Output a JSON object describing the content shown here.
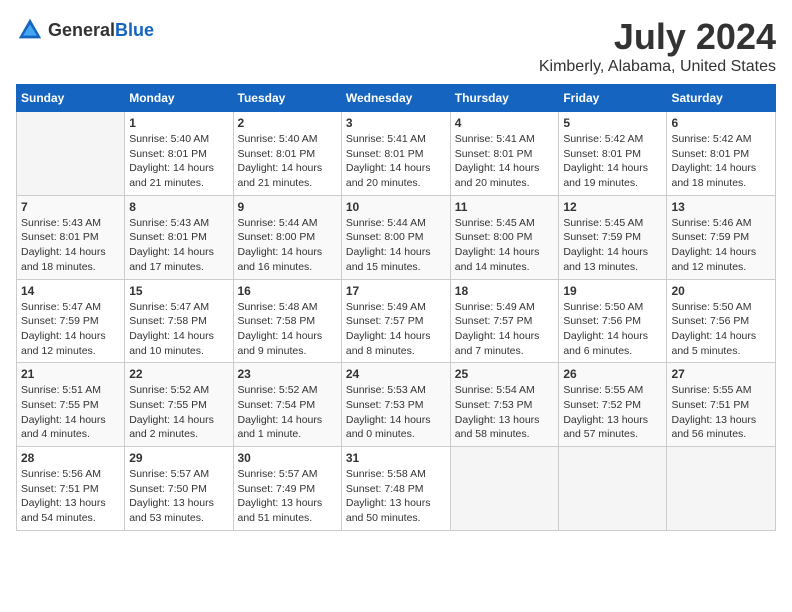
{
  "header": {
    "logo_general": "General",
    "logo_blue": "Blue",
    "title": "July 2024",
    "subtitle": "Kimberly, Alabama, United States"
  },
  "weekdays": [
    "Sunday",
    "Monday",
    "Tuesday",
    "Wednesday",
    "Thursday",
    "Friday",
    "Saturday"
  ],
  "weeks": [
    [
      {
        "day": "",
        "detail": ""
      },
      {
        "day": "1",
        "detail": "Sunrise: 5:40 AM\nSunset: 8:01 PM\nDaylight: 14 hours\nand 21 minutes."
      },
      {
        "day": "2",
        "detail": "Sunrise: 5:40 AM\nSunset: 8:01 PM\nDaylight: 14 hours\nand 21 minutes."
      },
      {
        "day": "3",
        "detail": "Sunrise: 5:41 AM\nSunset: 8:01 PM\nDaylight: 14 hours\nand 20 minutes."
      },
      {
        "day": "4",
        "detail": "Sunrise: 5:41 AM\nSunset: 8:01 PM\nDaylight: 14 hours\nand 20 minutes."
      },
      {
        "day": "5",
        "detail": "Sunrise: 5:42 AM\nSunset: 8:01 PM\nDaylight: 14 hours\nand 19 minutes."
      },
      {
        "day": "6",
        "detail": "Sunrise: 5:42 AM\nSunset: 8:01 PM\nDaylight: 14 hours\nand 18 minutes."
      }
    ],
    [
      {
        "day": "7",
        "detail": "Sunrise: 5:43 AM\nSunset: 8:01 PM\nDaylight: 14 hours\nand 18 minutes."
      },
      {
        "day": "8",
        "detail": "Sunrise: 5:43 AM\nSunset: 8:01 PM\nDaylight: 14 hours\nand 17 minutes."
      },
      {
        "day": "9",
        "detail": "Sunrise: 5:44 AM\nSunset: 8:00 PM\nDaylight: 14 hours\nand 16 minutes."
      },
      {
        "day": "10",
        "detail": "Sunrise: 5:44 AM\nSunset: 8:00 PM\nDaylight: 14 hours\nand 15 minutes."
      },
      {
        "day": "11",
        "detail": "Sunrise: 5:45 AM\nSunset: 8:00 PM\nDaylight: 14 hours\nand 14 minutes."
      },
      {
        "day": "12",
        "detail": "Sunrise: 5:45 AM\nSunset: 7:59 PM\nDaylight: 14 hours\nand 13 minutes."
      },
      {
        "day": "13",
        "detail": "Sunrise: 5:46 AM\nSunset: 7:59 PM\nDaylight: 14 hours\nand 12 minutes."
      }
    ],
    [
      {
        "day": "14",
        "detail": "Sunrise: 5:47 AM\nSunset: 7:59 PM\nDaylight: 14 hours\nand 12 minutes."
      },
      {
        "day": "15",
        "detail": "Sunrise: 5:47 AM\nSunset: 7:58 PM\nDaylight: 14 hours\nand 10 minutes."
      },
      {
        "day": "16",
        "detail": "Sunrise: 5:48 AM\nSunset: 7:58 PM\nDaylight: 14 hours\nand 9 minutes."
      },
      {
        "day": "17",
        "detail": "Sunrise: 5:49 AM\nSunset: 7:57 PM\nDaylight: 14 hours\nand 8 minutes."
      },
      {
        "day": "18",
        "detail": "Sunrise: 5:49 AM\nSunset: 7:57 PM\nDaylight: 14 hours\nand 7 minutes."
      },
      {
        "day": "19",
        "detail": "Sunrise: 5:50 AM\nSunset: 7:56 PM\nDaylight: 14 hours\nand 6 minutes."
      },
      {
        "day": "20",
        "detail": "Sunrise: 5:50 AM\nSunset: 7:56 PM\nDaylight: 14 hours\nand 5 minutes."
      }
    ],
    [
      {
        "day": "21",
        "detail": "Sunrise: 5:51 AM\nSunset: 7:55 PM\nDaylight: 14 hours\nand 4 minutes."
      },
      {
        "day": "22",
        "detail": "Sunrise: 5:52 AM\nSunset: 7:55 PM\nDaylight: 14 hours\nand 2 minutes."
      },
      {
        "day": "23",
        "detail": "Sunrise: 5:52 AM\nSunset: 7:54 PM\nDaylight: 14 hours\nand 1 minute."
      },
      {
        "day": "24",
        "detail": "Sunrise: 5:53 AM\nSunset: 7:53 PM\nDaylight: 14 hours\nand 0 minutes."
      },
      {
        "day": "25",
        "detail": "Sunrise: 5:54 AM\nSunset: 7:53 PM\nDaylight: 13 hours\nand 58 minutes."
      },
      {
        "day": "26",
        "detail": "Sunrise: 5:55 AM\nSunset: 7:52 PM\nDaylight: 13 hours\nand 57 minutes."
      },
      {
        "day": "27",
        "detail": "Sunrise: 5:55 AM\nSunset: 7:51 PM\nDaylight: 13 hours\nand 56 minutes."
      }
    ],
    [
      {
        "day": "28",
        "detail": "Sunrise: 5:56 AM\nSunset: 7:51 PM\nDaylight: 13 hours\nand 54 minutes."
      },
      {
        "day": "29",
        "detail": "Sunrise: 5:57 AM\nSunset: 7:50 PM\nDaylight: 13 hours\nand 53 minutes."
      },
      {
        "day": "30",
        "detail": "Sunrise: 5:57 AM\nSunset: 7:49 PM\nDaylight: 13 hours\nand 51 minutes."
      },
      {
        "day": "31",
        "detail": "Sunrise: 5:58 AM\nSunset: 7:48 PM\nDaylight: 13 hours\nand 50 minutes."
      },
      {
        "day": "",
        "detail": ""
      },
      {
        "day": "",
        "detail": ""
      },
      {
        "day": "",
        "detail": ""
      }
    ]
  ]
}
